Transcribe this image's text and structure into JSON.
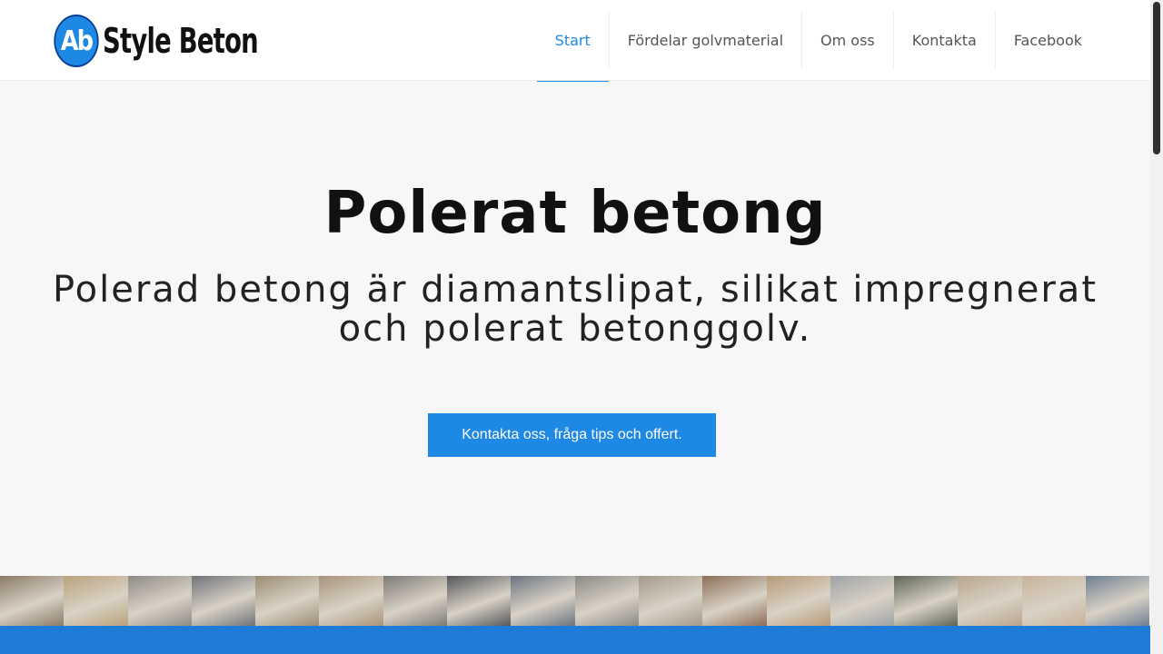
{
  "brand": {
    "logo_mark": "Ab",
    "logo_text": "Style Beton",
    "accent": "#1e88e5"
  },
  "nav": {
    "items": [
      {
        "label": "Start",
        "active": true
      },
      {
        "label": "Fördelar golvmaterial",
        "active": false
      },
      {
        "label": "Om oss",
        "active": false
      },
      {
        "label": "Kontakta",
        "active": false
      },
      {
        "label": "Facebook",
        "active": false
      }
    ]
  },
  "hero": {
    "title": "Polerat betong",
    "subtitle": "Polerad betong är diamantslipat, silikat impregnerat och polerat betonggolv.",
    "cta_label": "Kontakta oss, fråga tips och offert."
  },
  "gallery": {
    "thumb_colors": [
      "#8a7b67",
      "#b9a27a",
      "#8e8a86",
      "#6f7378",
      "#9a8c73",
      "#a8947a",
      "#7d7a77",
      "#54575c",
      "#6c7480",
      "#8b8985",
      "#a39a8c",
      "#8b6f57",
      "#b79a76",
      "#9fa3a6",
      "#606558",
      "#b9a58c",
      "#c7b29a",
      "#6f7f93"
    ]
  }
}
